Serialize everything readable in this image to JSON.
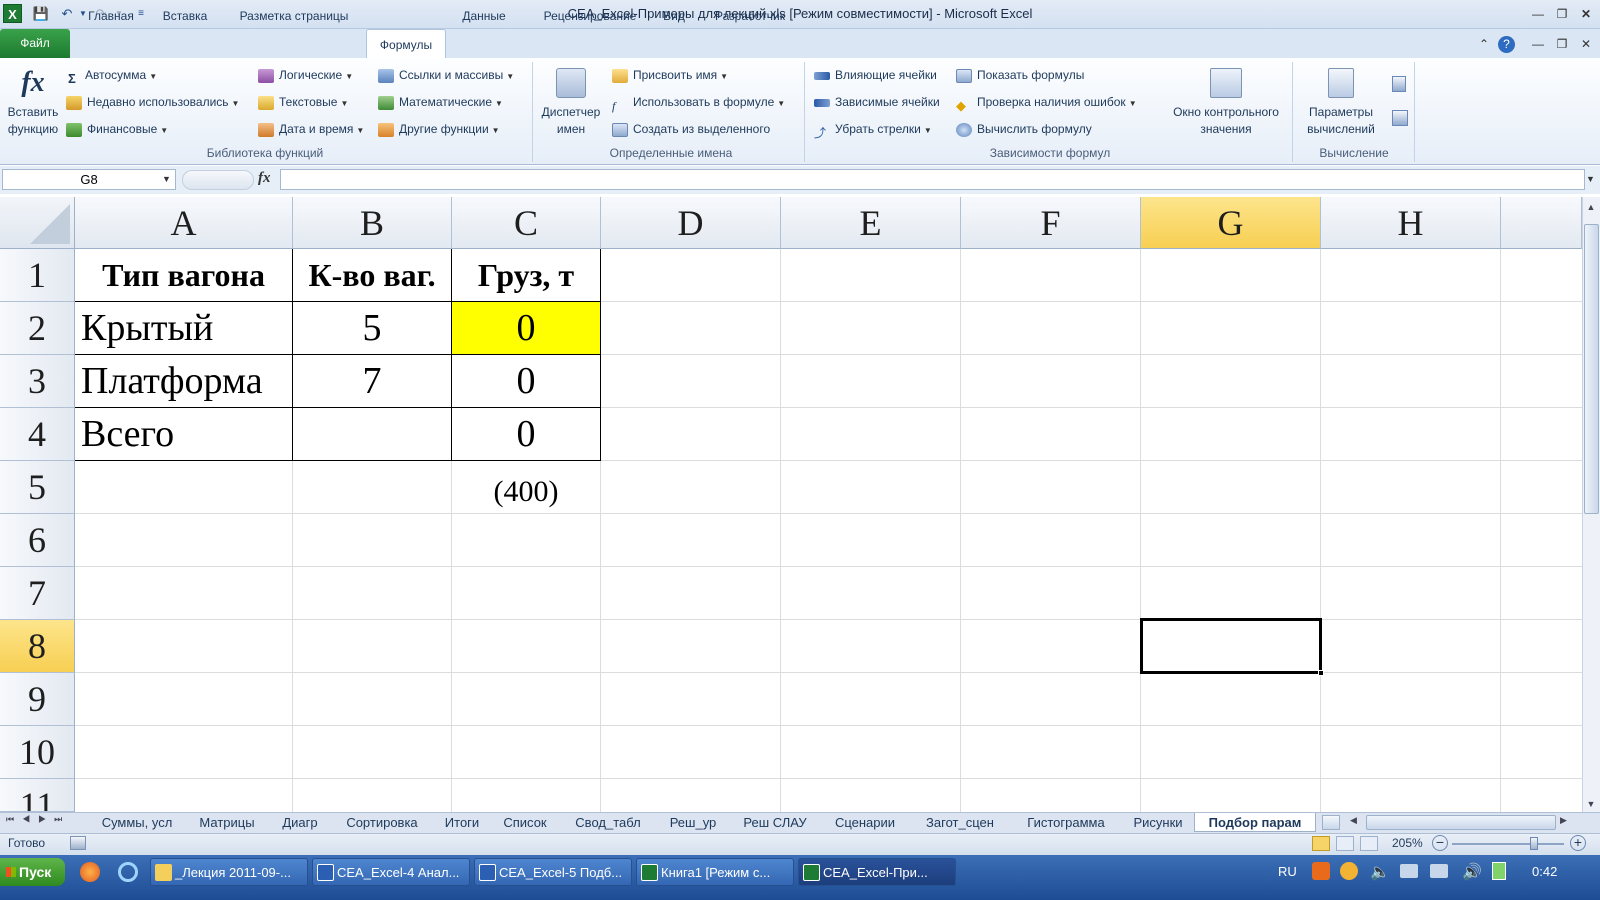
{
  "window": {
    "title": "CEA_Excel-Примеры для лекций.xls  [Режим совместимости]  -  Microsoft Excel"
  },
  "quick_access": {
    "save_icon": "save-icon",
    "undo_icon": "undo-icon",
    "redo_icon": "redo-icon"
  },
  "tabs": [
    "Файл",
    "Главная",
    "Вставка",
    "Разметка страницы",
    "Формулы",
    "Данные",
    "Рецензирование",
    "Вид",
    "Разработчик"
  ],
  "active_tab": "Формулы",
  "ribbon": {
    "insert_fn": "Вставить функцию",
    "insert_fn_l1": "Вставить",
    "insert_fn_l2": "функцию",
    "lib": {
      "autosum": "Автосумма",
      "recent": "Недавно использовались",
      "financial": "Финансовые",
      "logical": "Логические",
      "text": "Текстовые",
      "datetime": "Дата и время",
      "lookup": "Ссылки и массивы",
      "math": "Математические",
      "other": "Другие функции",
      "label": "Библиотека функций"
    },
    "names": {
      "manager_l1": "Диспетчер",
      "manager_l2": "имен",
      "define": "Присвоить имя",
      "use": "Использовать в формуле",
      "create": "Создать из выделенного",
      "label": "Определенные имена"
    },
    "audit": {
      "precedents": "Влияющие ячейки",
      "dependents": "Зависимые ячейки",
      "remove": "Убрать стрелки",
      "show": "Показать формулы",
      "errors": "Проверка наличия ошибок",
      "evaluate": "Вычислить формулу",
      "watch_l1": "Окно контрольного",
      "watch_l2": "значения",
      "label": "Зависимости формул"
    },
    "calc": {
      "options_l1": "Параметры",
      "options_l2": "вычислений",
      "label": "Вычисление"
    }
  },
  "formula_bar": {
    "name_box": "G8",
    "fx": "fx",
    "value": ""
  },
  "columns": [
    "A",
    "B",
    "C",
    "D",
    "E",
    "F",
    "G",
    "H"
  ],
  "rows": [
    "1",
    "2",
    "3",
    "4",
    "5",
    "6",
    "7",
    "8",
    "9",
    "10",
    "11"
  ],
  "cells": {
    "A1": "Тип вагона",
    "B1": "К-во ваг.",
    "C1": "Груз, т",
    "A2": "Крытый",
    "B2": "5",
    "C2": "0",
    "A3": "Платформа",
    "B3": "7",
    "C3": "0",
    "A4": "Всего",
    "B4": "",
    "C4": "0",
    "C5": "(400)"
  },
  "colors": {
    "highlight": "#ffff00",
    "selected_header": "#f9d65c",
    "file_tab": "#2a8b3a"
  },
  "sheet_tabs": [
    "Суммы, усл",
    "Матрицы",
    "Диагр",
    "Сортировка",
    "Итоги",
    "Список",
    "Свод_табл",
    "Реш_ур",
    "Реш СЛАУ",
    "Сценарии",
    "Загот_сцен",
    "Гистограмма",
    "Рисунки",
    "Подбор парам"
  ],
  "active_sheet": "Подбор парам",
  "status": {
    "ready": "Готово",
    "zoom": "205%"
  },
  "taskbar": {
    "start": "Пуск",
    "items": [
      "_Лекция 2011-09-...",
      "CEA_Excel-4 Анал...",
      "CEA_Excel-5 Подб...",
      "Книга1  [Режим с...",
      "CEA_Excel-При..."
    ],
    "lang": "RU",
    "clock": "0:42"
  }
}
